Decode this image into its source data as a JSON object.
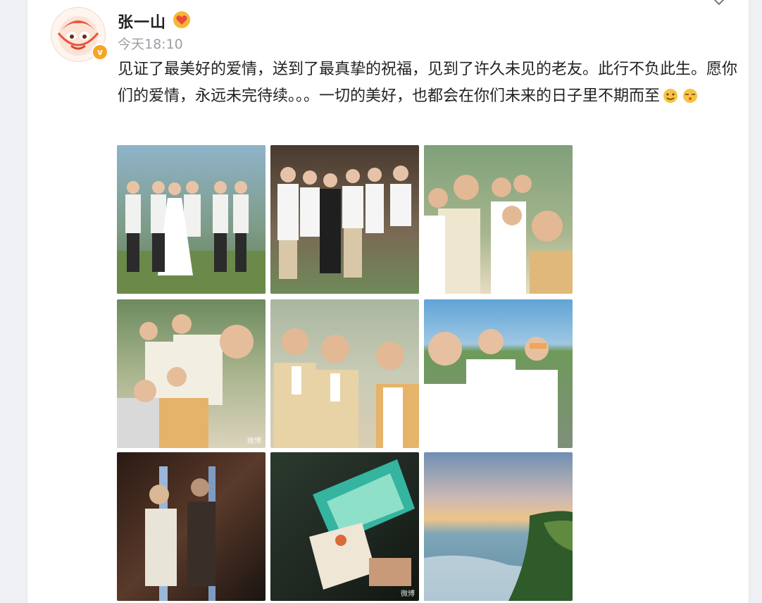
{
  "user": {
    "name": "张一山",
    "verified_mark": "v",
    "time": "今天18:10",
    "avatar_icon": "monkey-avatar-icon",
    "badge_icon": "gold-heart-badge-icon"
  },
  "post": {
    "text_main": "见证了最美好的爱情，送到了最真挚的祝福，见到了许久未见的老友。此行不负此生。愿你们的爱情，永远未完待续。。。一切的美好，也都会在你们未来的日子里不期而至",
    "emojis": [
      "hug-emoji",
      "kiss-emoji"
    ]
  },
  "photos": [
    {
      "id": "wedding-group-photo",
      "desc_icon": "photo"
    },
    {
      "id": "friends-casual-photo",
      "desc_icon": "photo"
    },
    {
      "id": "tuxedo-group-selfie",
      "desc_icon": "photo"
    },
    {
      "id": "garden-selfie",
      "desc_icon": "photo",
      "watermark": "微博"
    },
    {
      "id": "three-in-suits-photo",
      "desc_icon": "photo"
    },
    {
      "id": "seaside-selfie",
      "desc_icon": "photo"
    },
    {
      "id": "mirror-photo",
      "desc_icon": "photo"
    },
    {
      "id": "invitation-card-photo",
      "desc_icon": "photo",
      "watermark": "微博"
    },
    {
      "id": "sunset-sea-photo",
      "desc_icon": "photo"
    }
  ],
  "colors": {
    "accent": "#f5a623",
    "text": "#222222",
    "muted": "#9aa0a6"
  }
}
